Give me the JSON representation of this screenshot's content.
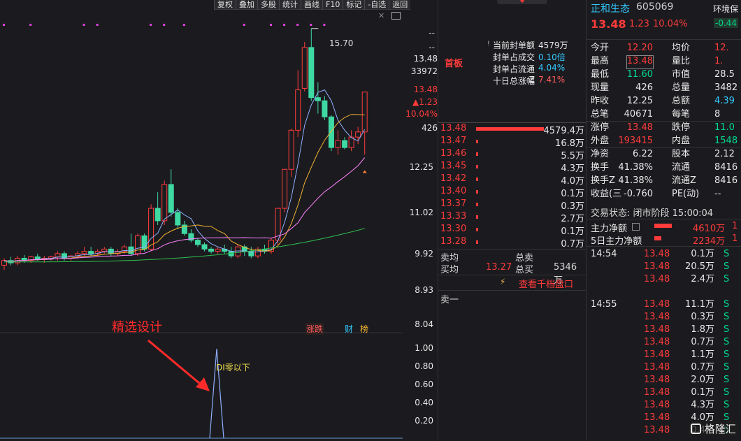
{
  "toolbar": {
    "items": [
      "复权",
      "叠加",
      "多股",
      "统计",
      "画线",
      "F10",
      "标记",
      "-自选",
      "返回"
    ]
  },
  "chart": {
    "high_label": "15.70",
    "right_axis": {
      "dash1": "--",
      "dash2": "--",
      "price": "13.48",
      "volume": "33972",
      "price2": "13.48",
      "change": "▲1.23",
      "pct": "10.04%",
      "vol_now": "426",
      "ticks": [
        "12.25",
        "11.02",
        "9.92",
        "8.93",
        "8.04"
      ]
    },
    "badges": {
      "zhangdie": "涨跌",
      "cai": "财",
      "bang": "榜"
    },
    "annotation": "精选设计",
    "indicator": {
      "label": "DI零以下",
      "ticks": [
        "1.00",
        "0.80",
        "0.60",
        "0.40",
        "0.20"
      ]
    },
    "colors": {
      "up": "#ff3b3b",
      "down": "#3fd9a3",
      "ma5": "#8fb0ff",
      "ma10": "#f0b030",
      "ma20": "#ff80ff",
      "ma60": "#2fbf4f"
    }
  },
  "chart_data": {
    "type": "candlestick",
    "high_marker": 15.7,
    "candles": [
      {
        "o": 8.9,
        "h": 9.05,
        "l": 8.8,
        "c": 9.0
      },
      {
        "o": 9.0,
        "h": 9.08,
        "l": 8.9,
        "c": 8.95
      },
      {
        "o": 8.95,
        "h": 9.1,
        "l": 8.9,
        "c": 9.05
      },
      {
        "o": 9.05,
        "h": 9.12,
        "l": 8.95,
        "c": 9.0
      },
      {
        "o": 9.0,
        "h": 9.1,
        "l": 8.95,
        "c": 9.08
      },
      {
        "o": 9.08,
        "h": 9.15,
        "l": 9.0,
        "c": 9.02
      },
      {
        "o": 9.02,
        "h": 9.1,
        "l": 8.95,
        "c": 9.05
      },
      {
        "o": 9.05,
        "h": 9.1,
        "l": 9.0,
        "c": 9.08
      },
      {
        "o": 9.08,
        "h": 9.2,
        "l": 9.0,
        "c": 9.15
      },
      {
        "o": 9.15,
        "h": 9.2,
        "l": 9.0,
        "c": 9.05
      },
      {
        "o": 9.05,
        "h": 9.12,
        "l": 9.0,
        "c": 9.1
      },
      {
        "o": 9.1,
        "h": 9.2,
        "l": 9.05,
        "c": 9.15
      },
      {
        "o": 9.15,
        "h": 9.3,
        "l": 9.1,
        "c": 9.2
      },
      {
        "o": 9.2,
        "h": 9.3,
        "l": 9.1,
        "c": 9.15
      },
      {
        "o": 9.15,
        "h": 9.25,
        "l": 9.1,
        "c": 9.2
      },
      {
        "o": 9.2,
        "h": 9.3,
        "l": 9.15,
        "c": 9.25
      },
      {
        "o": 9.25,
        "h": 9.3,
        "l": 9.1,
        "c": 9.15
      },
      {
        "o": 9.15,
        "h": 9.25,
        "l": 9.1,
        "c": 9.2
      },
      {
        "o": 9.2,
        "h": 9.35,
        "l": 9.15,
        "c": 9.3
      },
      {
        "o": 9.3,
        "h": 9.6,
        "l": 9.1,
        "c": 9.15
      },
      {
        "o": 9.15,
        "h": 9.6,
        "l": 9.1,
        "c": 9.55
      },
      {
        "o": 9.55,
        "h": 9.6,
        "l": 9.2,
        "c": 9.25
      },
      {
        "o": 9.25,
        "h": 10.3,
        "l": 9.2,
        "c": 10.2
      },
      {
        "o": 10.2,
        "h": 10.6,
        "l": 9.8,
        "c": 9.9
      },
      {
        "o": 9.9,
        "h": 10.9,
        "l": 9.8,
        "c": 10.8
      },
      {
        "o": 10.8,
        "h": 11.2,
        "l": 10.0,
        "c": 10.1
      },
      {
        "o": 10.1,
        "h": 10.2,
        "l": 9.7,
        "c": 9.8
      },
      {
        "o": 9.8,
        "h": 9.9,
        "l": 9.55,
        "c": 9.6
      },
      {
        "o": 9.6,
        "h": 9.7,
        "l": 9.4,
        "c": 9.45
      },
      {
        "o": 9.45,
        "h": 9.5,
        "l": 9.3,
        "c": 9.35
      },
      {
        "o": 9.35,
        "h": 9.4,
        "l": 9.2,
        "c": 9.25
      },
      {
        "o": 9.25,
        "h": 9.3,
        "l": 9.15,
        "c": 9.2
      },
      {
        "o": 9.2,
        "h": 9.3,
        "l": 9.15,
        "c": 9.25
      },
      {
        "o": 9.25,
        "h": 9.35,
        "l": 9.15,
        "c": 9.2
      },
      {
        "o": 9.2,
        "h": 9.3,
        "l": 9.05,
        "c": 9.1
      },
      {
        "o": 9.1,
        "h": 9.35,
        "l": 9.05,
        "c": 9.3
      },
      {
        "o": 9.3,
        "h": 9.35,
        "l": 9.1,
        "c": 9.2
      },
      {
        "o": 9.2,
        "h": 9.3,
        "l": 9.05,
        "c": 9.1
      },
      {
        "o": 9.1,
        "h": 9.3,
        "l": 9.05,
        "c": 9.25
      },
      {
        "o": 9.25,
        "h": 9.35,
        "l": 9.15,
        "c": 9.2
      },
      {
        "o": 9.2,
        "h": 9.5,
        "l": 9.15,
        "c": 9.45
      },
      {
        "o": 9.45,
        "h": 10.2,
        "l": 9.35,
        "c": 10.2
      },
      {
        "o": 10.2,
        "h": 11.2,
        "l": 10.1,
        "c": 11.2
      },
      {
        "o": 11.2,
        "h": 12.35,
        "l": 11.0,
        "c": 12.3
      },
      {
        "o": 12.3,
        "h": 14.2,
        "l": 12.1,
        "c": 13.55
      },
      {
        "o": 13.6,
        "h": 15.2,
        "l": 13.5,
        "c": 15.0
      },
      {
        "o": 15.0,
        "h": 15.7,
        "l": 13.2,
        "c": 13.3
      },
      {
        "o": 13.3,
        "h": 13.8,
        "l": 12.8,
        "c": 13.2
      },
      {
        "o": 13.2,
        "h": 13.35,
        "l": 12.6,
        "c": 12.7
      },
      {
        "o": 12.7,
        "h": 12.75,
        "l": 11.7,
        "c": 11.8
      },
      {
        "o": 11.8,
        "h": 12.3,
        "l": 11.6,
        "c": 12.0
      },
      {
        "o": 12.0,
        "h": 12.1,
        "l": 11.75,
        "c": 11.8
      },
      {
        "o": 11.8,
        "h": 12.3,
        "l": 11.7,
        "c": 12.1
      },
      {
        "o": 12.1,
        "h": 12.4,
        "l": 11.9,
        "c": 12.25
      },
      {
        "o": 12.25,
        "h": 13.48,
        "l": 11.6,
        "c": 13.48
      }
    ]
  },
  "order": {
    "title": "首板",
    "stats": [
      {
        "label": "当前封单额",
        "value": "4579万"
      },
      {
        "label": "封单占成交",
        "value": "0.10倍"
      },
      {
        "label": "封单占流通Z",
        "value": "4.04%"
      },
      {
        "label": "十日总涨幅",
        "value": "7.41%"
      }
    ],
    "bids": [
      {
        "price": "13.48",
        "vol": "4579.4万",
        "pct": 1.0
      },
      {
        "price": "13.47",
        "vol": "16.8万",
        "pct": 0.01
      },
      {
        "price": "13.46",
        "vol": "5.5万",
        "pct": 0.01
      },
      {
        "price": "13.45",
        "vol": "4.3万",
        "pct": 0.01
      },
      {
        "price": "13.42",
        "vol": "4.0万",
        "pct": 0.01
      },
      {
        "price": "13.40",
        "vol": "0.1万",
        "pct": 0.01
      },
      {
        "price": "13.37",
        "vol": "0.3万",
        "pct": 0.01
      },
      {
        "price": "13.33",
        "vol": "2.7万",
        "pct": 0.01
      },
      {
        "price": "13.30",
        "vol": "0.1万",
        "pct": 0.01
      },
      {
        "price": "13.28",
        "vol": "0.7万",
        "pct": 0.01
      }
    ],
    "sell_avg_label": "卖均",
    "total_sell_label": "总卖",
    "buy_avg_label": "买均",
    "buy_avg": "13.27",
    "total_buy_label": "总买",
    "total_buy": "5346万",
    "link": "查看千档盘口",
    "sell1": "卖一"
  },
  "quote": {
    "name": "正和生态",
    "code": "605069",
    "sector": "环境保",
    "sector_pct": "-0.44",
    "price": "13.48",
    "change": "1.23",
    "pct": "10.04%",
    "rows": [
      {
        "l1": "今开",
        "v1": "12.20",
        "c1": "red",
        "l2": "均价",
        "v2": "12.",
        "c2": "red"
      },
      {
        "l1": "最高",
        "v1": "13.48",
        "c1": "red",
        "l2": "量比",
        "v2": "1.",
        "c2": "red"
      },
      {
        "l1": "最低",
        "v1": "11.60",
        "c1": "green",
        "l2": "市值",
        "v2": "28.5",
        "c2": "white"
      },
      {
        "l1": "现量",
        "v1": "426",
        "c1": "white",
        "l2": "总量",
        "v2": "3482",
        "c2": "white"
      },
      {
        "l1": "昨收",
        "v1": "12.25",
        "c1": "white",
        "l2": "总额",
        "v2": "4.39",
        "c2": "cyan"
      },
      {
        "l1": "总笔",
        "v1": "40671",
        "c1": "white",
        "l2": "每笔",
        "v2": "8",
        "c2": "white"
      },
      {
        "l1": "涨停",
        "v1": "13.48",
        "c1": "red",
        "l2": "跌停",
        "v2": "11.0",
        "c2": "green"
      },
      {
        "l1": "外盘",
        "v1": "193415",
        "c1": "red",
        "l2": "内盘",
        "v2": "1548",
        "c2": "green"
      },
      {
        "l1": "净资",
        "v1": "6.22",
        "c1": "white",
        "l2": "股本",
        "v2": "2.12",
        "c2": "white"
      },
      {
        "l1": "换手",
        "v1": "41.38%",
        "c1": "white",
        "l2": "流通",
        "v2": "8416",
        "c2": "white"
      },
      {
        "l1": "换手Z",
        "v1": "41.38%",
        "c1": "white",
        "l2": "流通Z",
        "v2": "8416",
        "c2": "white"
      },
      {
        "l1": "收益(三",
        "v1": "-0.760",
        "c1": "white",
        "l2": "PE(动)",
        "v2": "--",
        "c2": "white"
      }
    ],
    "trade_status": "交易状态: 闭市阶段 15:00:04",
    "main_flow_label": "主力净额",
    "main_flow": "4610万",
    "main_flow_tail": "1",
    "flow5_label": "5日主力净额",
    "flow5": "2234万",
    "flow5_tail": "1",
    "ticks": [
      {
        "t": "14:54",
        "p": "13.48",
        "v": "0.1万",
        "s": "S"
      },
      {
        "t": "",
        "p": "13.48",
        "v": "20.5万",
        "s": "S"
      },
      {
        "t": "",
        "p": "13.48",
        "v": "2.4万",
        "s": "S"
      },
      {
        "t": "14:55",
        "p": "13.48",
        "v": "11.1万",
        "s": "S"
      },
      {
        "t": "",
        "p": "13.48",
        "v": "0.3万",
        "s": "S"
      },
      {
        "t": "",
        "p": "13.48",
        "v": "1.8万",
        "s": "S"
      },
      {
        "t": "",
        "p": "13.48",
        "v": "0.7万",
        "s": "S"
      },
      {
        "t": "",
        "p": "13.48",
        "v": "1.1万",
        "s": "S"
      },
      {
        "t": "",
        "p": "13.48",
        "v": "0.7万",
        "s": "S"
      },
      {
        "t": "",
        "p": "13.48",
        "v": "2.0万",
        "s": "S"
      },
      {
        "t": "",
        "p": "13.48",
        "v": "0.1万",
        "s": "S"
      },
      {
        "t": "",
        "p": "13.48",
        "v": "4.3万",
        "s": "S"
      },
      {
        "t": "",
        "p": "13.48",
        "v": "4.0万",
        "s": "S"
      },
      {
        "t": "",
        "p": "13.48",
        "v": "0.4万",
        "s": "S"
      }
    ],
    "watermark": "格隆汇"
  }
}
